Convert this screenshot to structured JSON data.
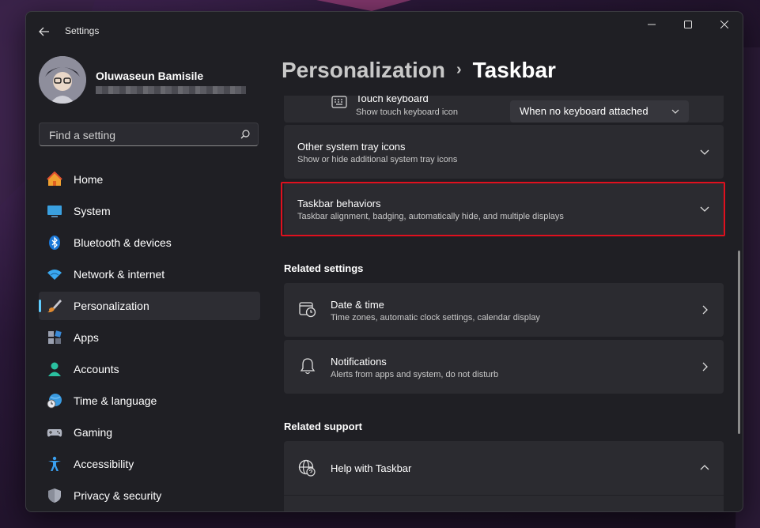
{
  "window": {
    "app_title": "Settings"
  },
  "profile": {
    "name": "Oluwaseun Bamisile"
  },
  "search": {
    "placeholder": "Find a setting"
  },
  "nav": [
    {
      "label": "Home",
      "icon": "home-icon"
    },
    {
      "label": "System",
      "icon": "monitor-icon"
    },
    {
      "label": "Bluetooth & devices",
      "icon": "bluetooth-icon"
    },
    {
      "label": "Network & internet",
      "icon": "wifi-icon"
    },
    {
      "label": "Personalization",
      "icon": "brush-icon",
      "active": true
    },
    {
      "label": "Apps",
      "icon": "apps-icon"
    },
    {
      "label": "Accounts",
      "icon": "person-icon"
    },
    {
      "label": "Time & language",
      "icon": "globe-clock-icon"
    },
    {
      "label": "Gaming",
      "icon": "gamepad-icon"
    },
    {
      "label": "Accessibility",
      "icon": "accessibility-icon"
    },
    {
      "label": "Privacy & security",
      "icon": "shield-icon"
    }
  ],
  "breadcrumb": {
    "parent": "Personalization",
    "separator": "›",
    "current": "Taskbar"
  },
  "settings": {
    "touch_keyboard": {
      "title": "Touch keyboard",
      "subtitle": "Show touch keyboard icon",
      "dropdown_value": "When no keyboard attached"
    },
    "other_tray": {
      "title": "Other system tray icons",
      "subtitle": "Show or hide additional system tray icons"
    },
    "behaviors": {
      "title": "Taskbar behaviors",
      "subtitle": "Taskbar alignment, badging, automatically hide, and multiple displays"
    }
  },
  "related_settings": {
    "heading": "Related settings",
    "date_time": {
      "title": "Date & time",
      "subtitle": "Time zones, automatic clock settings, calendar display"
    },
    "notifications": {
      "title": "Notifications",
      "subtitle": "Alerts from apps and system, do not disturb"
    }
  },
  "related_support": {
    "heading": "Related support",
    "help": {
      "title": "Help with Taskbar"
    }
  },
  "colors": {
    "accent": "#60cdff",
    "highlight": "#e0101e",
    "card": "#2b2b30",
    "window": "#1f1f24"
  }
}
